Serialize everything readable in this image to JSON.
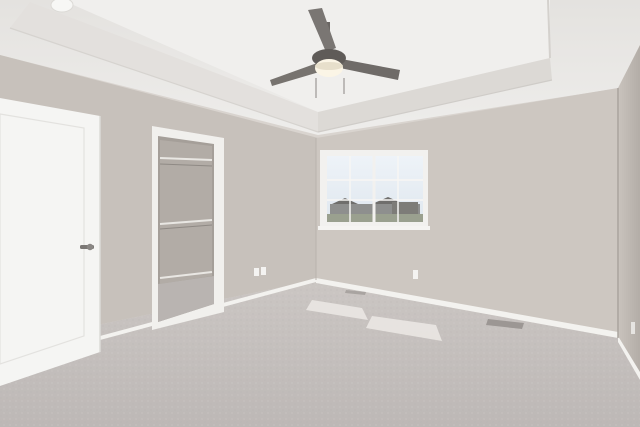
{
  "scene": {
    "subject": "empty-bedroom",
    "elements": [
      "tray-ceiling",
      "ceiling-fan",
      "smoke-detector",
      "window",
      "walk-in-closet",
      "door",
      "carpet",
      "baseboards",
      "outlets",
      "floor-vent"
    ]
  },
  "colors": {
    "wall_left": "#c7c1bb",
    "wall_back": "#cdc7c1",
    "wall_right": "#bdb7b1",
    "ceiling": "#e9e8e6",
    "tray": "#dedbd7",
    "trim": "#f3f2ef",
    "carpet": "#c3bebc",
    "door": "#f5f5f3",
    "fan": "#6a6663",
    "closet_shadow": "#a59f99"
  }
}
